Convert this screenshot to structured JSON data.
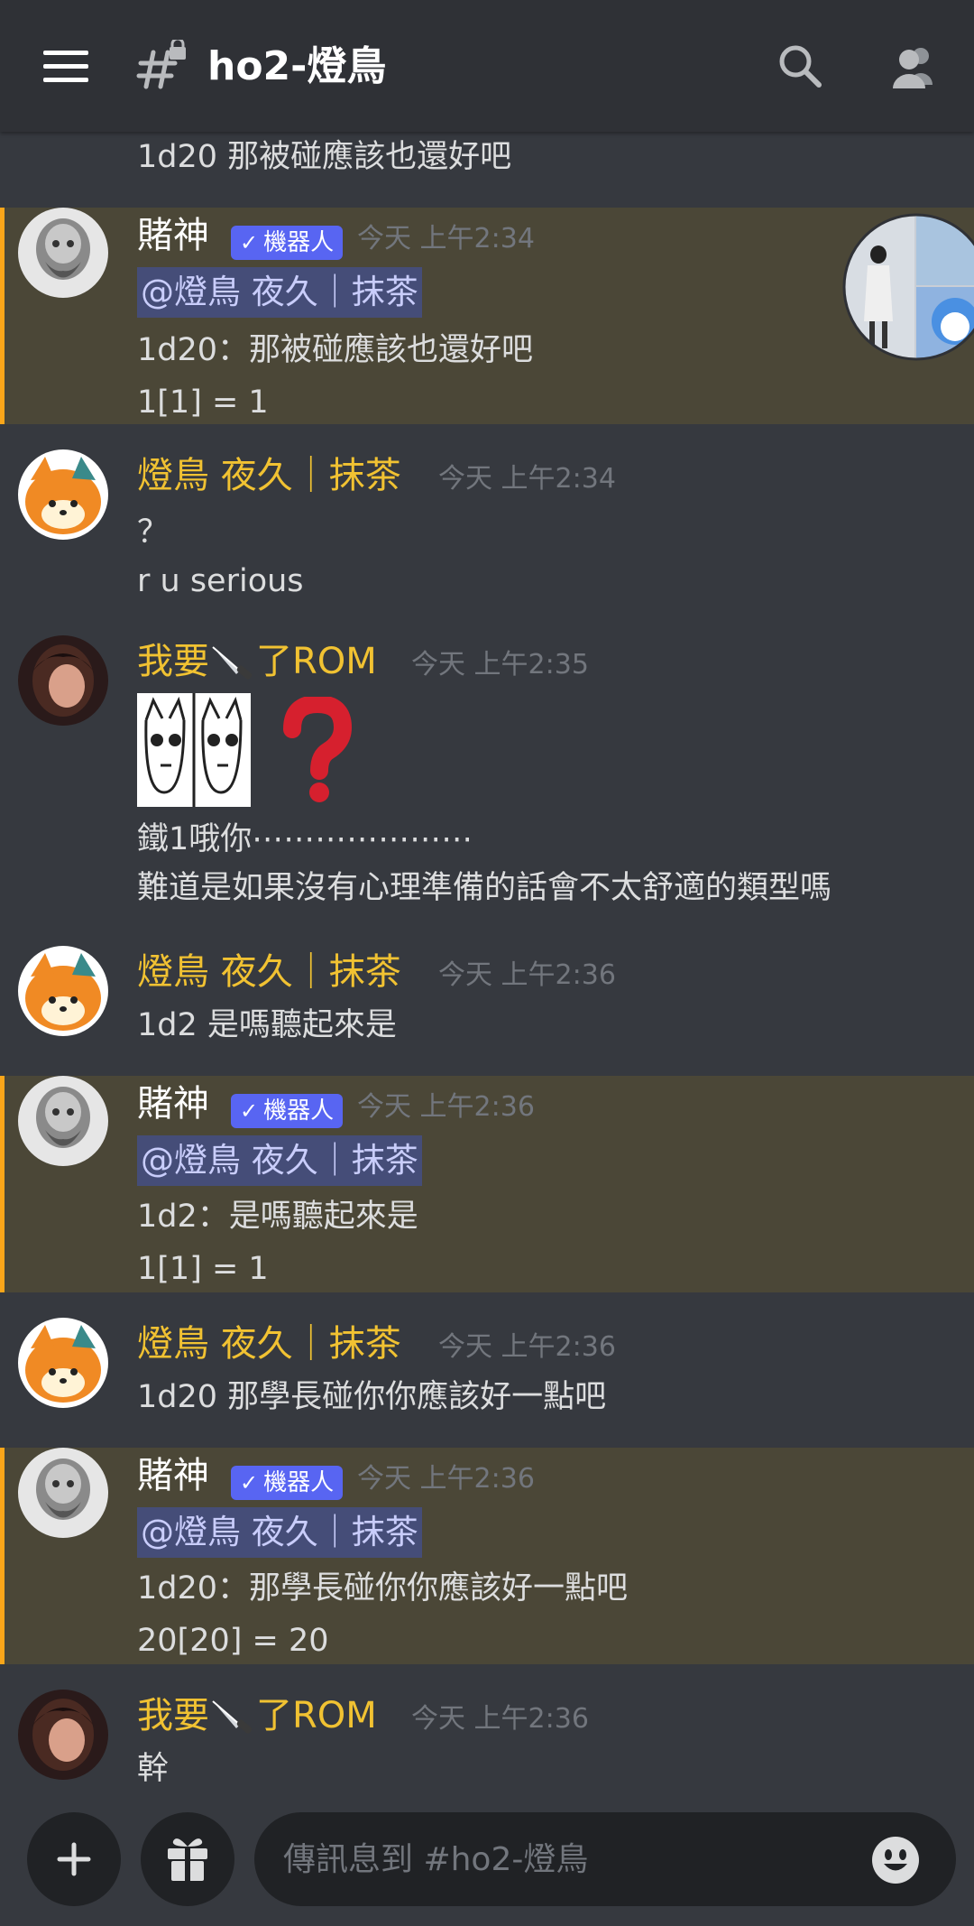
{
  "header": {
    "channel_name": "ho2-燈鳥",
    "icons": [
      "hamburger-icon",
      "locked-channel-icon",
      "search-icon",
      "members-icon"
    ]
  },
  "messages": {
    "partial": {
      "text": "1d20 那被碰應該也還好吧"
    },
    "m1": {
      "author": "賭神",
      "bot_tag": "機器人",
      "timestamp": "今天 上午2:34",
      "mention": "@燈鳥 夜久｜抹茶",
      "line1": "1d20：那被碰應該也還好吧",
      "line2": "1[1] = 1"
    },
    "m2": {
      "author": "燈鳥 夜久｜抹茶",
      "timestamp": "今天 上午2:34",
      "line1": "？",
      "line2": "r u serious"
    },
    "m3": {
      "author_prefix": "我要",
      "author_suffix": "了ROM",
      "timestamp": "今天 上午2:35",
      "line1": "鐵1哦你⋯⋯⋯⋯⋯⋯⋯",
      "line2": "難道是如果沒有心理準備的話會不太舒適的類型嗎",
      "sticker_glyph": "❓"
    },
    "m4": {
      "author": "燈鳥 夜久｜抹茶",
      "timestamp": "今天 上午2:36",
      "line1": "1d2 是嗎聽起來是"
    },
    "m5": {
      "author": "賭神",
      "bot_tag": "機器人",
      "timestamp": "今天 上午2:36",
      "mention": "@燈鳥 夜久｜抹茶",
      "line1": "1d2：是嗎聽起來是",
      "line2": "1[1] = 1"
    },
    "m6": {
      "author": "燈鳥 夜久｜抹茶",
      "timestamp": "今天 上午2:36",
      "line1": "1d20 那學長碰你你應該好一點吧"
    },
    "m7": {
      "author": "賭神",
      "bot_tag": "機器人",
      "timestamp": "今天 上午2:36",
      "mention": "@燈鳥 夜久｜抹茶",
      "line1": "1d20：那學長碰你你應該好一點吧",
      "line2": "20[20] = 20"
    },
    "m8": {
      "author_prefix": "我要",
      "author_suffix": "了ROM",
      "timestamp": "今天 上午2:36",
      "line1": "幹"
    }
  },
  "input": {
    "placeholder": "傳訊息到 #ho2-燈鳥"
  },
  "colors": {
    "background": "#36393f",
    "header": "#2f3136",
    "highlight": "#4b4737",
    "highlight_bar": "#faa61a",
    "bot_tag": "#5865f2",
    "mention_bg": "#454d78",
    "username_gold": "#f1c232"
  }
}
